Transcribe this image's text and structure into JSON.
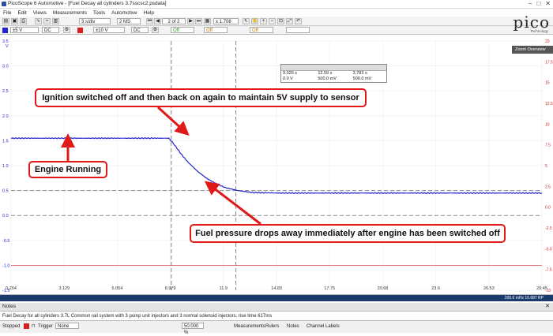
{
  "window": {
    "title": "PicoScope 6 Automotive - [Fuel Decay all cylinders 3.7sscsc2.psdata]",
    "controls": [
      "–",
      "□",
      "✕"
    ]
  },
  "menu": [
    "File",
    "Edit",
    "Views",
    "Measurements",
    "Tools",
    "Automotive",
    "Help"
  ],
  "toolbar1": {
    "timebase": "3 s/div",
    "sample_count": "2 MS",
    "buffer_position": "2 of 2",
    "zoom_level": "x 1.708"
  },
  "toolbar2": {
    "channel_a": {
      "range": "±5 V",
      "coupling": "DC",
      "filter": "Off"
    },
    "channel_b": {
      "range": "±10 V",
      "coupling": "DC",
      "filter": "Off"
    },
    "trigger_level": "Off"
  },
  "logo": {
    "text": "pico",
    "subtitle": "Technology"
  },
  "chart_data": {
    "type": "line",
    "units_y": "V",
    "x_ticks": [
      "0.204",
      "3.129",
      "6.054",
      "8.979",
      "11.9",
      "14.83",
      "17.75",
      "20.68",
      "23.6",
      "26.53",
      "29.45"
    ],
    "y_ticks_left": [
      "3.5",
      "3.0",
      "2.5",
      "2.0",
      "1.5",
      "1.0",
      "0.5",
      "0.0",
      "-0.5",
      "-1.0",
      "-1.5"
    ],
    "y_ticks_right": [
      "20",
      "17.5",
      "15",
      "12.5",
      "10",
      "7.5",
      "5",
      "2.5",
      "0.0",
      "-2.5",
      "-5.0",
      "-7.5",
      "-10"
    ],
    "xlim": [
      0.204,
      29.45
    ],
    "ylim": [
      -1.5,
      3.5
    ],
    "series": [
      {
        "color": "#2323cc",
        "x": [
          0.204,
          3,
          6,
          8.9,
          9.2,
          9.6,
          10.0,
          10.5,
          11.0,
          11.5,
          12.0,
          12.7,
          13.5,
          15,
          20,
          25,
          29.45
        ],
        "y": [
          1.55,
          1.55,
          1.55,
          1.55,
          1.42,
          1.22,
          1.05,
          0.88,
          0.74,
          0.64,
          0.56,
          0.5,
          0.46,
          0.45,
          0.45,
          0.45,
          0.45
        ]
      },
      {
        "color": "#e05050",
        "x": [
          0.204,
          29.45
        ],
        "y": [
          -1.0,
          -1.0
        ]
      }
    ],
    "rulers": {
      "time": [
        9.03,
        12.59
      ],
      "volts": [
        0.5,
        0.0
      ]
    }
  },
  "ruler_table": {
    "rows": [
      [
        "9.026 s",
        "12.59 s",
        "3.783 s"
      ],
      [
        "0.0 V",
        "500.0 mV",
        "500.0 mV"
      ]
    ]
  },
  "zoom_overview": "Zoom Overview",
  "annotations": [
    "Ignition switched off and then back on again to maintain 5V supply to sensor",
    "Engine Running",
    "Fuel pressure drops away immediately after engine has been switched off"
  ],
  "freq_readout": "265.6 mHz 15.687 RP",
  "notes": {
    "header": "Notes",
    "text": "Fuel Decay for all cylinders 3.7L Common rail system with 3 pump unit injectors and 3 normal solenoid injectors, rise time 617ms"
  },
  "status": {
    "run_state": "Stopped",
    "trigger_label": "Trigger",
    "trigger_value": "None",
    "measurements": "Measurements",
    "rulers": "Rulers",
    "notes": "Notes",
    "channel_labels": "Channel Labels",
    "zoom_pct": "50.000 %"
  },
  "colors": {
    "trace": "#2323cc",
    "callout_border": "#e01818",
    "ruler": "#888888",
    "bottom_bar": "#1c3a6e"
  }
}
